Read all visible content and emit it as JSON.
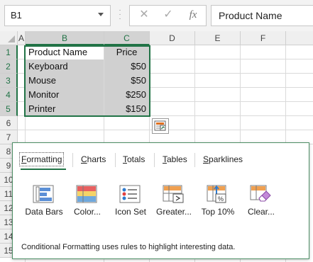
{
  "formula_bar": {
    "name_box": "B1",
    "cancel_icon": "✕",
    "enter_icon": "✓",
    "fx_label": "fx",
    "content": "Product Name"
  },
  "columns": [
    "A",
    "B",
    "C",
    "D",
    "E",
    "F"
  ],
  "rows": [
    "1",
    "2",
    "3",
    "4",
    "5",
    "6",
    "7",
    "8",
    "9",
    "10",
    "11",
    "12",
    "13",
    "14",
    "15"
  ],
  "table": {
    "headers": [
      "Product Name",
      "Price"
    ],
    "rows": [
      [
        "Keyboard",
        "$50"
      ],
      [
        "Mouse",
        "$50"
      ],
      [
        "Monitor",
        "$250"
      ],
      [
        "Printer",
        "$150"
      ]
    ]
  },
  "quick_analysis": {
    "tabs": [
      "Formatting",
      "Charts",
      "Totals",
      "Tables",
      "Sparklines"
    ],
    "active_tab": "Formatting",
    "options": [
      {
        "label": "Data Bars",
        "icon": "data-bars-icon"
      },
      {
        "label": "Color...",
        "icon": "color-scale-icon"
      },
      {
        "label": "Icon Set",
        "icon": "icon-set-icon"
      },
      {
        "label": "Greater...",
        "icon": "greater-than-icon"
      },
      {
        "label": "Top 10%",
        "icon": "top-ten-percent-icon"
      },
      {
        "label": "Clear...",
        "icon": "clear-format-icon"
      }
    ],
    "description": "Conditional Formatting uses rules to highlight interesting data."
  },
  "colors": {
    "accent": "#217346",
    "selection_fill": "#d0d0d0"
  }
}
